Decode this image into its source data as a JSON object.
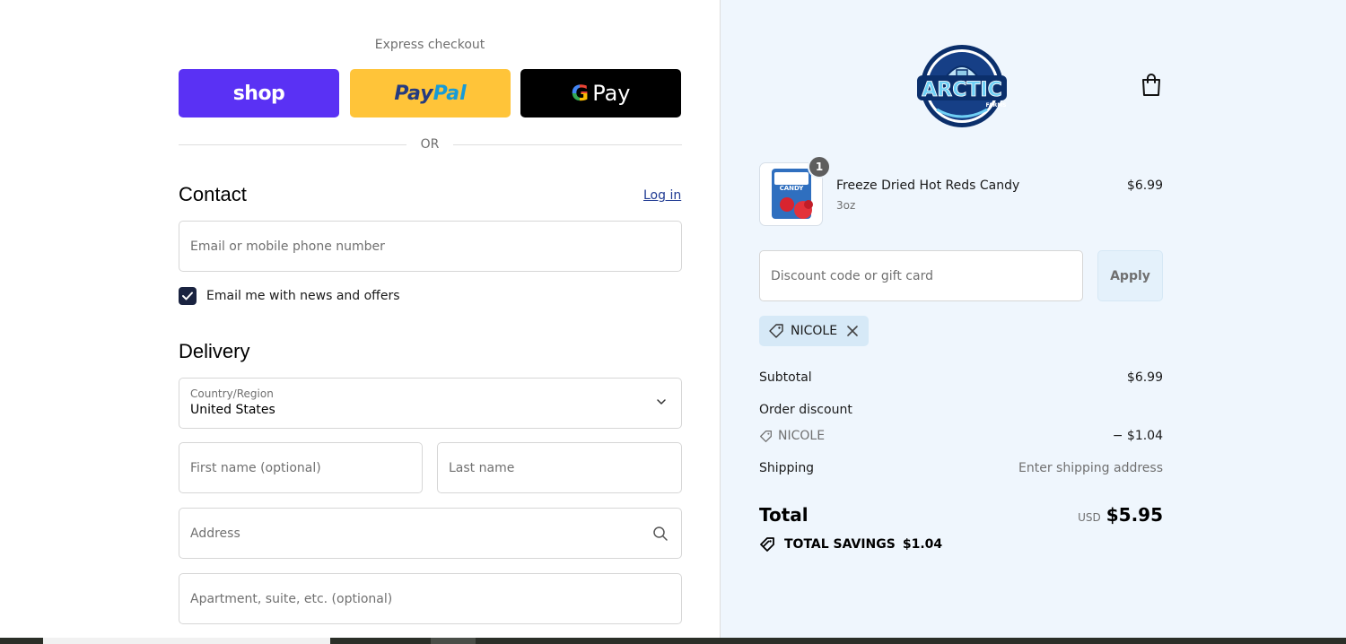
{
  "express": {
    "label": "Express checkout",
    "shop_label": "shop",
    "paypal_part1": "Pay",
    "paypal_part2": "Pal",
    "gpay_g": "G",
    "gpay_label": "Pay",
    "or_label": "OR"
  },
  "contact": {
    "title": "Contact",
    "login_label": "Log in",
    "email_placeholder": "Email or mobile phone number",
    "newsletter_label": "Email me with news and offers",
    "newsletter_checked": true
  },
  "delivery": {
    "title": "Delivery",
    "country_label": "Country/Region",
    "country_value": "United States",
    "first_name_placeholder": "First name (optional)",
    "last_name_placeholder": "Last name",
    "address_placeholder": "Address",
    "apartment_placeholder": "Apartment, suite, etc. (optional)"
  },
  "brand": {
    "logo_text": "ARCTIC",
    "logo_sub": "FARMS"
  },
  "cart": {
    "item": {
      "name": "Freeze Dried Hot Reds Candy",
      "variant": "3oz",
      "price": "$6.99",
      "quantity": "1",
      "thumb_text": "CANDY"
    },
    "discount_placeholder": "Discount code or gift card",
    "apply_label": "Apply",
    "applied_code": "NICOLE"
  },
  "summary": {
    "subtotal_label": "Subtotal",
    "subtotal_value": "$6.99",
    "order_discount_label": "Order discount",
    "discount_code": "NICOLE",
    "discount_value": "− $1.04",
    "shipping_label": "Shipping",
    "shipping_value": "Enter shipping address",
    "total_label": "Total",
    "currency": "USD",
    "total_value": "$5.95",
    "savings_label": "TOTAL SAVINGS",
    "savings_value": "$1.04"
  },
  "colors": {
    "shop": "#5a31f4",
    "paypal": "#ffc439",
    "gpay": "#000000",
    "summary_bg": "#eff6fd",
    "checkbox": "#1a2340"
  }
}
